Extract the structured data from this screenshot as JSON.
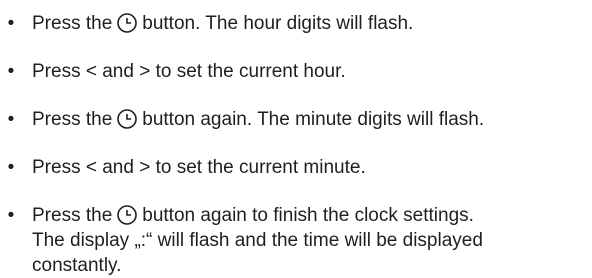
{
  "bullet": "•",
  "icon": "clock-icon",
  "steps": [
    {
      "before": "Press the",
      "after": "button. The hour digits will flash."
    },
    {
      "text": "Press < and > to set the current hour."
    },
    {
      "before": "Press the",
      "after": "button again. The minute digits will flash."
    },
    {
      "text": "Press < and > to set the current minute."
    },
    {
      "before": "Press the",
      "after": "button again to finish the clock settings.",
      "line2": "The display „:“ will flash and the time will be displayed",
      "line3": "constantly."
    }
  ]
}
